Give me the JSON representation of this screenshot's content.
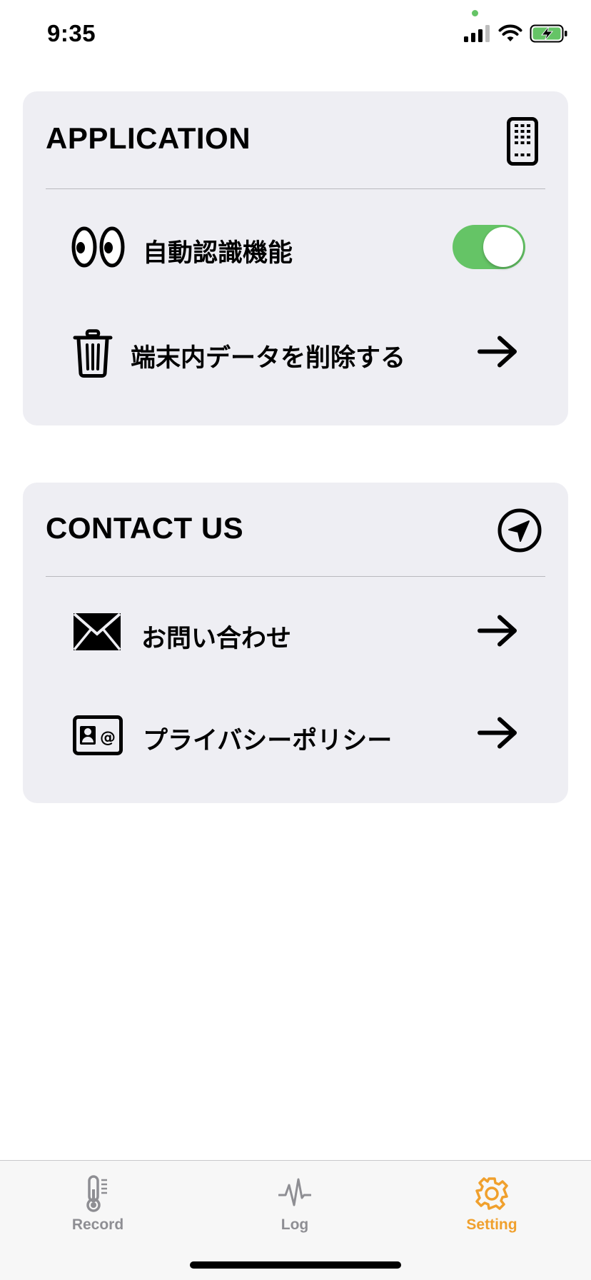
{
  "status_bar": {
    "time": "9:35",
    "icons": [
      "cellular-signal-icon",
      "wifi-icon",
      "battery-charging-icon"
    ],
    "indicator_color": "#65c466"
  },
  "application_section": {
    "title": "APPLICATION",
    "header_icon": "smartphone-icon",
    "rows": [
      {
        "icon": "eyes-icon",
        "label": "自動認識機能",
        "control": "toggle",
        "toggle_on": true
      },
      {
        "icon": "trash-icon",
        "label": "端末内データを削除する",
        "control": "arrow-right-icon"
      }
    ]
  },
  "contact_section": {
    "title": "CONTACT US",
    "header_icon": "paper-plane-icon",
    "rows": [
      {
        "icon": "envelope-icon",
        "label": "お問い合わせ",
        "control": "arrow-right-icon"
      },
      {
        "icon": "contact-card-icon",
        "label": "プライバシーポリシー",
        "control": "arrow-right-icon"
      }
    ]
  },
  "tab_bar": {
    "tabs": [
      {
        "label": "Record",
        "icon": "thermometer-icon",
        "active": false
      },
      {
        "label": "Log",
        "icon": "pulse-icon",
        "active": false
      },
      {
        "label": "Setting",
        "icon": "gear-icon",
        "active": true
      }
    ],
    "active_color": "#f0a02d",
    "inactive_color": "#8e8e93"
  },
  "colors": {
    "card_background": "#eeeef3",
    "toggle_on": "#65c466"
  }
}
